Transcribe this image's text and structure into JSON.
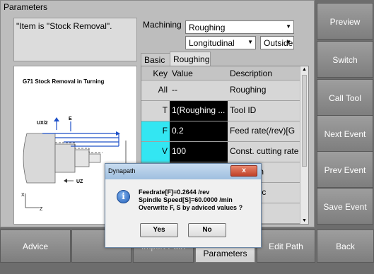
{
  "panel": {
    "title": "Parameters",
    "note": "\"Item is \"Stock Removal\"."
  },
  "figure": {
    "title": "G71 Stock Removal in Turning",
    "labels": {
      "ux2": "UX/2",
      "e": "E",
      "d": "D",
      "uz": "UZ",
      "x": "X",
      "z": "Z"
    }
  },
  "machining": {
    "label": "Machining",
    "mode": "Roughing",
    "direction": "Longitudinal",
    "side": "Outside"
  },
  "tabs": [
    "Basic",
    "Roughing"
  ],
  "grid": {
    "headers": {
      "key": "Key",
      "value": "Value",
      "desc": "Description"
    },
    "rows": [
      {
        "key": "All",
        "value": "--",
        "desc": "Roughing"
      },
      {
        "key": "T",
        "value": "1(Roughing ...",
        "desc": "Tool ID"
      },
      {
        "key": "F",
        "value": "0.2",
        "desc": "Feed rate(/rev)[G"
      },
      {
        "key": "V",
        "value": "100",
        "desc": "Const. cutting rate"
      },
      {
        "key": "",
        "value": "",
        "desc": "speed lin"
      },
      {
        "key": "",
        "value": "",
        "desc": "n of spinc"
      },
      {
        "key": "",
        "value": "",
        "desc": ""
      }
    ]
  },
  "side_buttons": [
    "Preview",
    "Switch",
    "Call Tool",
    "Next Event",
    "Prev Event",
    "Save Event"
  ],
  "bottom_buttons": {
    "advice": "Advice",
    "import_path": "Import Path",
    "parameters": "Parameters",
    "edit_path": "Edit Path",
    "back": "Back"
  },
  "dialog": {
    "title": "Dynapath",
    "close": "x",
    "lines": [
      "Feedrate[F]=0.2644 /rev",
      "Spindle Speed[S]=60.0000 /min",
      "Overwrite F, S by adviced values ?"
    ],
    "yes": "Yes",
    "no": "No"
  },
  "colors": {
    "cyan_key": "#33e6f2",
    "black_value": "#000000"
  }
}
